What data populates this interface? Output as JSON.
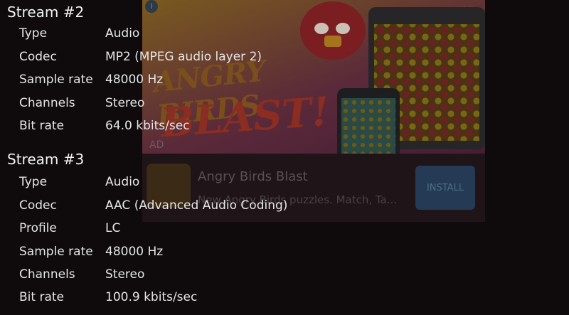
{
  "ad": {
    "logo_top": "ANGRY BIRDS",
    "logo_bottom": "BLAST!",
    "label": "AD",
    "app_name": "Angry Birds Blast",
    "app_desc": "New Angry Birds puzzles. Match, Ta...",
    "install_label": "INSTALL",
    "close_icon": "close-icon",
    "info_icon": "info-icon"
  },
  "streams": [
    {
      "title": "Stream #2",
      "rows": [
        {
          "key": "Type",
          "value": "Audio"
        },
        {
          "key": "Codec",
          "value": "MP2 (MPEG audio layer 2)"
        },
        {
          "key": "Sample rate",
          "value": "48000 Hz"
        },
        {
          "key": "Channels",
          "value": "Stereo"
        },
        {
          "key": "Bit rate",
          "value": "64.0 kbits/sec"
        }
      ]
    },
    {
      "title": "Stream #3",
      "rows": [
        {
          "key": "Type",
          "value": "Audio"
        },
        {
          "key": "Codec",
          "value": "AAC (Advanced Audio Coding)"
        },
        {
          "key": "Profile",
          "value": "LC"
        },
        {
          "key": "Sample rate",
          "value": "48000 Hz"
        },
        {
          "key": "Channels",
          "value": "Stereo"
        },
        {
          "key": "Bit rate",
          "value": "100.9 kbits/sec"
        }
      ]
    }
  ]
}
